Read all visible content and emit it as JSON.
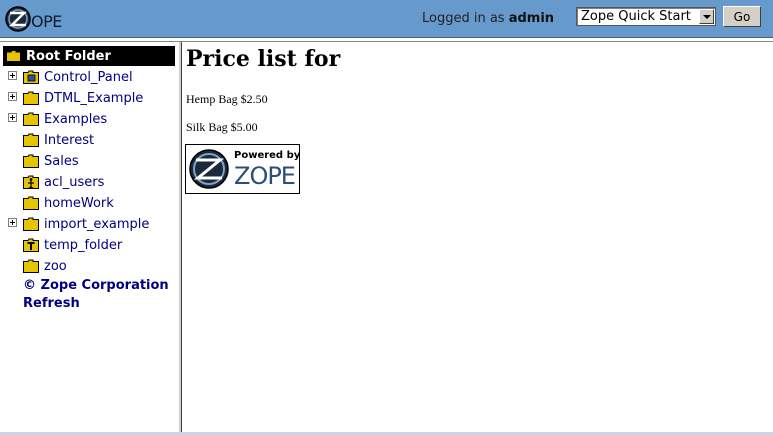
{
  "header": {
    "logged_in_prefix": "Logged in as",
    "username": "admin",
    "quick_start_selected": "Zope Quick Start",
    "go_label": "Go"
  },
  "tree": {
    "root_label": "Root Folder",
    "items": [
      {
        "label": "Control_Panel",
        "expandable": true,
        "icon": "control-panel-icon"
      },
      {
        "label": "DTML_Example",
        "expandable": true,
        "icon": "folder-icon"
      },
      {
        "label": "Examples",
        "expandable": true,
        "icon": "folder-icon"
      },
      {
        "label": "Interest",
        "expandable": false,
        "icon": "folder-icon"
      },
      {
        "label": "Sales",
        "expandable": false,
        "icon": "folder-icon"
      },
      {
        "label": "acl_users",
        "expandable": false,
        "icon": "user-folder-icon"
      },
      {
        "label": "homeWork",
        "expandable": false,
        "icon": "folder-icon"
      },
      {
        "label": "import_example",
        "expandable": true,
        "icon": "folder-icon"
      },
      {
        "label": "temp_folder",
        "expandable": false,
        "icon": "temp-folder-icon"
      },
      {
        "label": "zoo",
        "expandable": false,
        "icon": "folder-icon"
      }
    ],
    "copyright": "© Zope Corporation",
    "refresh": "Refresh"
  },
  "main": {
    "title": "Price list for",
    "prices": [
      {
        "text": "Hemp Bag $2.50"
      },
      {
        "text": "Silk Bag $5.00"
      }
    ],
    "powered_by": "Powered by",
    "powered_brand": "ZOPE"
  },
  "colors": {
    "header_bg": "#6699cc",
    "link": "#000080",
    "folder": "#e6c400"
  }
}
